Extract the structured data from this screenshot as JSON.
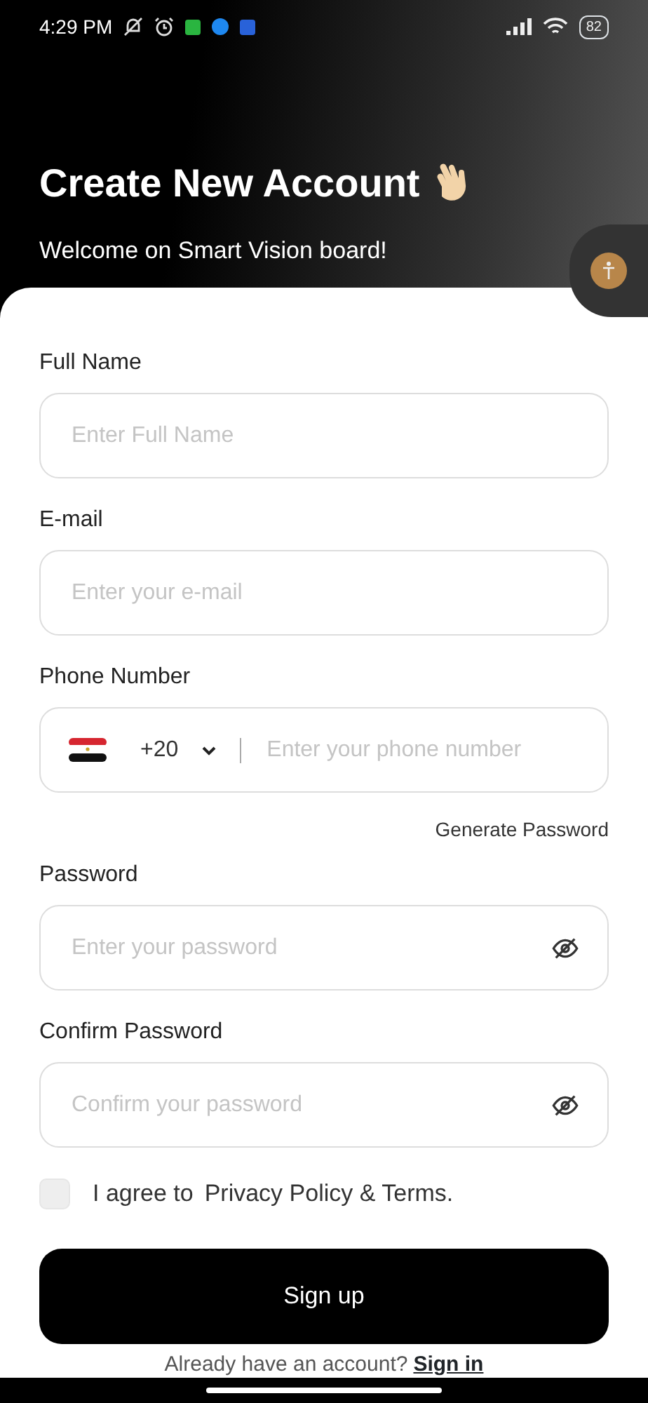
{
  "status_bar": {
    "time": "4:29 PM",
    "battery": "82"
  },
  "header": {
    "title": "Create New Account",
    "subtitle": "Welcome on Smart Vision board!"
  },
  "fields": [
    {
      "kind": "text",
      "label": "Full Name",
      "placeholder": "Enter Full Name"
    },
    {
      "kind": "text",
      "label": "E-mail",
      "placeholder": "Enter your e-mail"
    },
    {
      "kind": "phone",
      "label": "Phone Number",
      "country_code": "+20",
      "placeholder": "Enter your phone number"
    },
    {
      "kind": "link",
      "text": "Generate Password"
    },
    {
      "kind": "password",
      "label": "Password",
      "placeholder": "Enter your password"
    },
    {
      "kind": "password",
      "label": "Confirm Password",
      "placeholder": "Confirm your password"
    }
  ],
  "agree": {
    "checked": false,
    "text": "I agree to",
    "link": "Privacy Policy & Terms."
  },
  "submit": "Sign up",
  "footer": {
    "text": "Already have an account?",
    "link": "Sign in"
  }
}
